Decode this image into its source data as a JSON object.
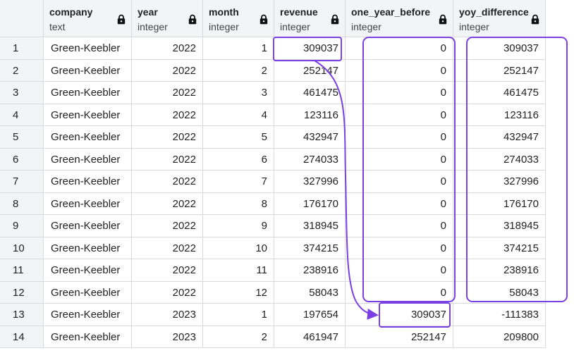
{
  "columns": [
    {
      "name": "company",
      "type": "text"
    },
    {
      "name": "year",
      "type": "integer"
    },
    {
      "name": "month",
      "type": "integer"
    },
    {
      "name": "revenue",
      "type": "integer"
    },
    {
      "name": "one_year_before",
      "type": "integer"
    },
    {
      "name": "yoy_difference",
      "type": "integer"
    }
  ],
  "lock_icon": "lock-icon",
  "rows": [
    [
      "1",
      "Green-Keebler",
      "2022",
      "1",
      "309037",
      "0",
      "309037"
    ],
    [
      "2",
      "Green-Keebler",
      "2022",
      "2",
      "252147",
      "0",
      "252147"
    ],
    [
      "3",
      "Green-Keebler",
      "2022",
      "3",
      "461475",
      "0",
      "461475"
    ],
    [
      "4",
      "Green-Keebler",
      "2022",
      "4",
      "123116",
      "0",
      "123116"
    ],
    [
      "5",
      "Green-Keebler",
      "2022",
      "5",
      "432947",
      "0",
      "432947"
    ],
    [
      "6",
      "Green-Keebler",
      "2022",
      "6",
      "274033",
      "0",
      "274033"
    ],
    [
      "7",
      "Green-Keebler",
      "2022",
      "7",
      "327996",
      "0",
      "327996"
    ],
    [
      "8",
      "Green-Keebler",
      "2022",
      "8",
      "176170",
      "0",
      "176170"
    ],
    [
      "9",
      "Green-Keebler",
      "2022",
      "9",
      "318945",
      "0",
      "318945"
    ],
    [
      "10",
      "Green-Keebler",
      "2022",
      "10",
      "374215",
      "0",
      "374215"
    ],
    [
      "11",
      "Green-Keebler",
      "2022",
      "11",
      "238916",
      "0",
      "238916"
    ],
    [
      "12",
      "Green-Keebler",
      "2022",
      "12",
      "58043",
      "0",
      "58043"
    ],
    [
      "13",
      "Green-Keebler",
      "2023",
      "1",
      "197654",
      "309037",
      "-111383"
    ],
    [
      "14",
      "Green-Keebler",
      "2023",
      "2",
      "461947",
      "252147",
      "209800"
    ]
  ],
  "highlight_color": "#7b3fe4"
}
